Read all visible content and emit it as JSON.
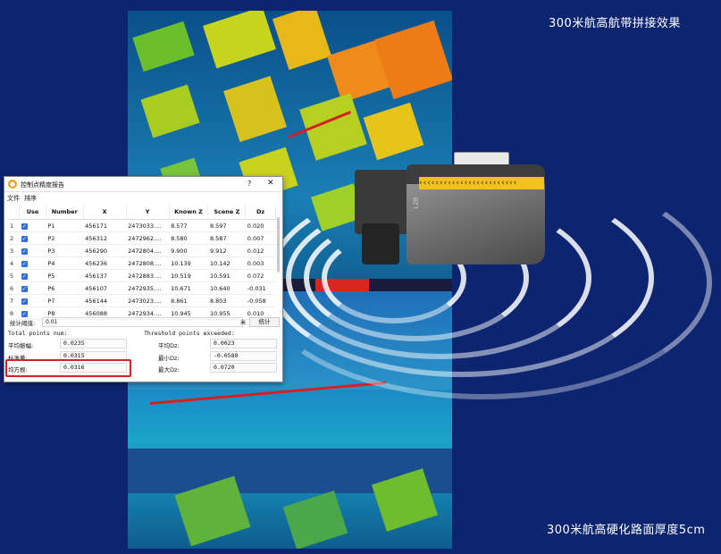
{
  "captions": {
    "top": "300米航高航带拼接效果",
    "bottom": "300米航高硬化路面厚度5cm"
  },
  "colors": {
    "background": "#0d2470",
    "accent_red": "#d0242a",
    "checkbox_blue": "#2f6fd6",
    "scanner_stripe": "#f2c21a"
  },
  "dialog": {
    "title": "控制点精度报告",
    "help_label": "?",
    "close_label": "✕",
    "menu": [
      "文件",
      "排序"
    ],
    "columns": [
      "",
      "Use",
      "Number",
      "X",
      "Y",
      "Known Z",
      "Scene Z",
      "Dz"
    ],
    "rows": [
      {
        "idx": "1",
        "use": true,
        "number": "P1",
        "x": "456171",
        "y": "2473033....",
        "known_z": "8.577",
        "scene_z": "8.597",
        "dz": "0.020"
      },
      {
        "idx": "2",
        "use": true,
        "number": "P2",
        "x": "456312",
        "y": "2472962....",
        "known_z": "8.580",
        "scene_z": "8.587",
        "dz": "0.007"
      },
      {
        "idx": "3",
        "use": true,
        "number": "P3",
        "x": "456290",
        "y": "2472804....",
        "known_z": "9.900",
        "scene_z": "9.912",
        "dz": "0.012"
      },
      {
        "idx": "4",
        "use": true,
        "number": "P4",
        "x": "456236",
        "y": "2472808....",
        "known_z": "10.139",
        "scene_z": "10.142",
        "dz": "0.003"
      },
      {
        "idx": "5",
        "use": true,
        "number": "P5",
        "x": "456137",
        "y": "2472883....",
        "known_z": "10.519",
        "scene_z": "10.591",
        "dz": "0.072"
      },
      {
        "idx": "6",
        "use": true,
        "number": "P6",
        "x": "456107",
        "y": "2472935....",
        "known_z": "10.671",
        "scene_z": "10.640",
        "dz": "-0.031"
      },
      {
        "idx": "7",
        "use": true,
        "number": "P7",
        "x": "456144",
        "y": "2473023....",
        "known_z": "8.861",
        "scene_z": "8.803",
        "dz": "-0.058"
      },
      {
        "idx": "8",
        "use": true,
        "number": "P8",
        "x": "456088",
        "y": "2472934....",
        "known_z": "10.945",
        "scene_z": "10.955",
        "dz": "0.010"
      }
    ],
    "stat_label": "统计阈值:",
    "stat_value": "0.01",
    "stat_mark": "米",
    "stat_button": "统计",
    "total_header": "Total points num:",
    "threshold_header": "Threshold points exceeded:",
    "left_results": [
      {
        "label": "平均振幅:",
        "value": "0.0235"
      },
      {
        "label": "标准差:",
        "value": "0.0315"
      },
      {
        "label": "均方根:",
        "value": "0.0316"
      }
    ],
    "right_results": [
      {
        "label": "平均Dz:",
        "value": "0.0023"
      },
      {
        "label": "最小Dz:",
        "value": "-0.0580"
      },
      {
        "label": "最大Dz:",
        "value": "0.0720"
      }
    ]
  },
  "scanner": {
    "model_label": "L2B"
  }
}
